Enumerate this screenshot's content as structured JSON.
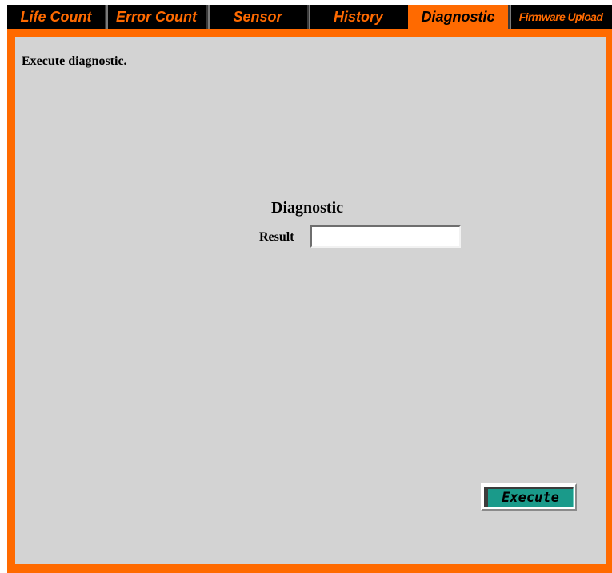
{
  "tabs": [
    {
      "label": "Life Count",
      "active": false
    },
    {
      "label": "Error Count",
      "active": false
    },
    {
      "label": "Sensor",
      "active": false
    },
    {
      "label": "History",
      "active": false
    },
    {
      "label": "Diagnostic",
      "active": true
    },
    {
      "label": "Firmware Upload",
      "active": false
    }
  ],
  "main": {
    "instruction": "Execute diagnostic.",
    "section_title": "Diagnostic",
    "result_label": "Result",
    "result_value": "",
    "execute_label": "Execute"
  },
  "colors": {
    "accent": "#ff6a00",
    "tab_background": "#000000",
    "content_background": "#d3d3d3",
    "button_face": "#1a9a8a"
  }
}
